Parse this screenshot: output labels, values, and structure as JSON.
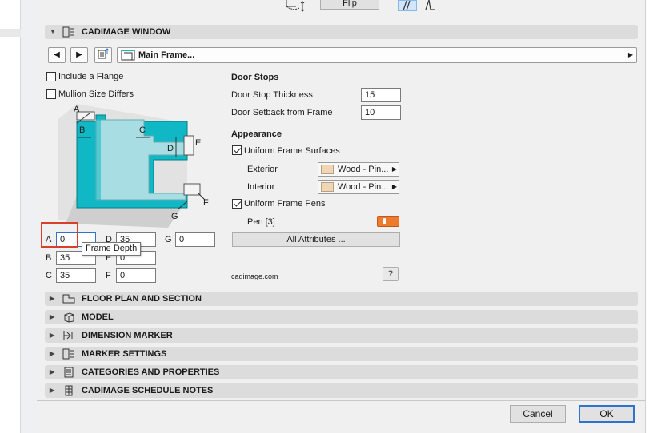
{
  "toolbar_top": {
    "flip_label": "Flip"
  },
  "sections": {
    "cadimage_window": "CADIMAGE WINDOW",
    "floor_plan": "FLOOR PLAN AND SECTION",
    "model": "MODEL",
    "dimension_marker": "DIMENSION MARKER",
    "marker_settings": "MARKER SETTINGS",
    "categories": "CATEGORIES AND PROPERTIES",
    "schedule_notes": "CADIMAGE SCHEDULE NOTES"
  },
  "nav": {
    "page_label": "Main Frame..."
  },
  "options": {
    "include_flange": {
      "label": "Include a Flange",
      "checked": false
    },
    "mullion_differs": {
      "label": "Mullion Size Differs",
      "checked": false
    }
  },
  "diagram": {
    "labels": {
      "a": "A",
      "b": "B",
      "c": "C",
      "d": "D",
      "e": "E",
      "f": "F",
      "g": "G"
    },
    "colors": {
      "frame": "#0fb8c4",
      "inner": "#a8dde3",
      "base": "#d8d8d8"
    }
  },
  "dimensions": {
    "a": {
      "label": "A",
      "value": "0"
    },
    "b": {
      "label": "B",
      "value": "35"
    },
    "c": {
      "label": "C",
      "value": "35"
    },
    "d": {
      "label": "D",
      "value": "35"
    },
    "e": {
      "label": "E",
      "value": "0"
    },
    "f": {
      "label": "F",
      "value": "0"
    },
    "g": {
      "label": "G",
      "value": "0"
    }
  },
  "tooltip": "Frame Depth",
  "door_stops": {
    "heading": "Door Stops",
    "thickness_label": "Door Stop Thickness",
    "thickness_value": "15",
    "setback_label": "Door Setback from Frame",
    "setback_value": "10"
  },
  "appearance": {
    "heading": "Appearance",
    "uniform_surfaces": {
      "label": "Uniform Frame Surfaces",
      "checked": true
    },
    "exterior_label": "Exterior",
    "exterior_material": "Wood - Pin...",
    "interior_label": "Interior",
    "interior_material": "Wood - Pin...",
    "uniform_pens": {
      "label": "Uniform Frame Pens",
      "checked": true
    },
    "pen_label": "Pen [3]",
    "pen_color": "#ee7a2e",
    "all_attributes_label": "All Attributes ..."
  },
  "brand": "cadimage.com",
  "help_label": "?",
  "footer": {
    "cancel_label": "Cancel",
    "ok_label": "OK"
  }
}
